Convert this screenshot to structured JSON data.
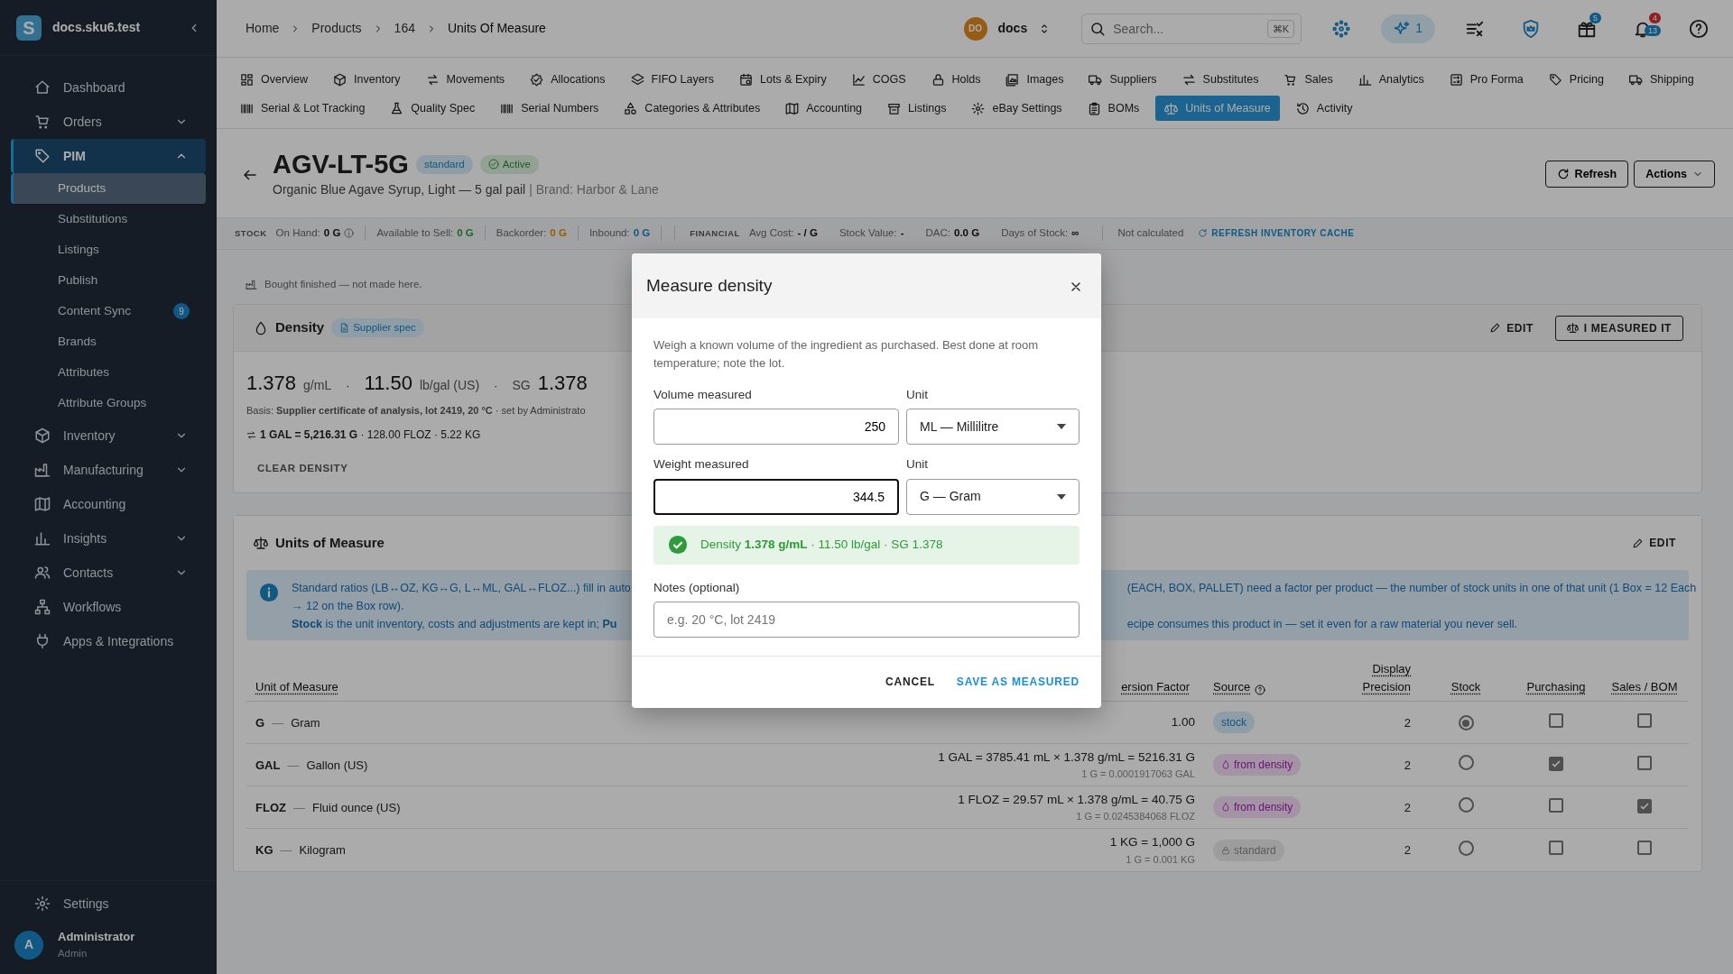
{
  "sidebar": {
    "logo": "S",
    "workspace": "docs.sku6.test",
    "items": [
      {
        "label": "Dashboard",
        "kind": "link",
        "selected": false
      },
      {
        "label": "Orders",
        "kind": "group",
        "expanded": false,
        "selected": false
      },
      {
        "label": "PIM",
        "kind": "group",
        "expanded": true,
        "selected": true,
        "children": [
          {
            "label": "Products",
            "selected": true
          },
          {
            "label": "Substitutions",
            "selected": false
          },
          {
            "label": "Listings",
            "selected": false
          },
          {
            "label": "Publish",
            "selected": false
          },
          {
            "label": "Content Sync",
            "selected": false,
            "badge": "9"
          },
          {
            "label": "Brands",
            "selected": false
          },
          {
            "label": "Attributes",
            "selected": false
          },
          {
            "label": "Attribute Groups",
            "selected": false
          }
        ]
      },
      {
        "label": "Inventory",
        "kind": "group",
        "expanded": false,
        "selected": false
      },
      {
        "label": "Manufacturing",
        "kind": "group",
        "expanded": false,
        "selected": false
      },
      {
        "label": "Accounting",
        "kind": "link",
        "selected": false
      },
      {
        "label": "Insights",
        "kind": "group",
        "expanded": false,
        "selected": false
      },
      {
        "label": "Contacts",
        "kind": "group",
        "expanded": false,
        "selected": false
      },
      {
        "label": "Workflows",
        "kind": "link",
        "selected": false
      },
      {
        "label": "Apps & Integrations",
        "kind": "link",
        "selected": false
      }
    ],
    "settings": "Settings",
    "user": {
      "initial": "A",
      "name": "Administrator",
      "role": "Admin"
    }
  },
  "header": {
    "breadcrumb": [
      "Home",
      "Products",
      "164",
      "Units Of Measure"
    ],
    "account": {
      "initials": "DO",
      "name": "docs"
    },
    "search": {
      "placeholder": "Search...",
      "shortcut": "⌘K"
    },
    "ai_count": "1",
    "gift_badge": "5",
    "notification_badges": [
      "4",
      "13"
    ]
  },
  "tabs": [
    {
      "label": "Overview",
      "selected": false
    },
    {
      "label": "Inventory",
      "selected": false
    },
    {
      "label": "Movements",
      "selected": false
    },
    {
      "label": "Allocations",
      "selected": false
    },
    {
      "label": "FIFO Layers",
      "selected": false
    },
    {
      "label": "Lots & Expiry",
      "selected": false
    },
    {
      "label": "COGS",
      "selected": false
    },
    {
      "label": "Holds",
      "selected": false
    },
    {
      "label": "Images",
      "selected": false
    },
    {
      "label": "Suppliers",
      "selected": false
    },
    {
      "label": "Substitutes",
      "selected": false
    },
    {
      "label": "Sales",
      "selected": false
    },
    {
      "label": "Analytics",
      "selected": false
    },
    {
      "label": "Pro Forma",
      "selected": false
    },
    {
      "label": "Pricing",
      "selected": false
    },
    {
      "label": "Shipping",
      "selected": false
    },
    {
      "label": "Serial & Lot Tracking",
      "selected": false
    },
    {
      "label": "Quality Spec",
      "selected": false
    },
    {
      "label": "Serial Numbers",
      "selected": false
    },
    {
      "label": "Categories & Attributes",
      "selected": false
    },
    {
      "label": "Accounting",
      "selected": false
    },
    {
      "label": "Listings",
      "selected": false
    },
    {
      "label": "eBay Settings",
      "selected": false
    },
    {
      "label": "BOMs",
      "selected": false
    },
    {
      "label": "Units of Measure",
      "selected": true
    },
    {
      "label": "Activity",
      "selected": false
    }
  ],
  "product": {
    "sku": "AGV-LT-5G",
    "badges": [
      {
        "label": "standard",
        "kind": "type"
      },
      {
        "label": "Active",
        "kind": "status"
      }
    ],
    "name": "Organic Blue Agave Syrup, Light — 5 gal pail",
    "brand": "| Brand: Harbor & Lane",
    "refresh": "Refresh",
    "actions": "Actions"
  },
  "stock_bar": {
    "sections": [
      {
        "title": "STOCK",
        "stats": [
          {
            "label": "On Hand:",
            "value": "0 G",
            "kind": "plain",
            "info": true
          },
          {
            "label": "Available to Sell:",
            "value": "0 G",
            "kind": "success"
          },
          {
            "label": "Backorder:",
            "value": "0 G",
            "kind": "warning"
          },
          {
            "label": "Inbound:",
            "value": "0 G",
            "kind": "info"
          }
        ]
      },
      {
        "title": "FINANCIAL",
        "stats": [
          {
            "label": "Avg Cost:",
            "value": "- / G",
            "kind": "plain"
          },
          {
            "label": "Stock Value:",
            "value": "-",
            "kind": "plain"
          },
          {
            "label": "DAC:",
            "value": "0.0 G",
            "kind": "plain"
          },
          {
            "label": "Days of Stock:",
            "value": "∞",
            "kind": "plain"
          }
        ]
      }
    ],
    "note": "Not calculated",
    "action": "REFRESH INVENTORY CACHE"
  },
  "notice": "Bought finished — not made here.",
  "density": {
    "title": "Density",
    "source": "Supplier spec",
    "edit": "EDIT",
    "measure": "I MEASURED IT",
    "separator": "·",
    "readings": [
      {
        "value": "1.378",
        "unit": "g/mL"
      },
      {
        "value": "11.50",
        "unit": "lb/gal (US)"
      },
      {
        "prefix": "SG",
        "value": "1.378"
      }
    ],
    "basis": "Basis: **Supplier certificate of analysis, lot 2419, 20 °C** · set by Administrato",
    "conversions": "**1 GAL = 5,216.31 G** · 128.00 FLOZ · 5.22 KG",
    "clear": "CLEAR DENSITY"
  },
  "uom": {
    "title": "Units of Measure",
    "edit": "EDIT",
    "info": [
      {
        "left": "Standard ratios (LB↔OZ, KG↔G, L↔ML, GAL↔FLOZ...) fill in auto",
        "right": "(EACH, BOX, PALLET) need a factor per product — the number of stock units in one of that unit (1 Box = 12 Each"
      },
      {
        "left": "→ 12 on the Box row)."
      },
      {
        "left": "**Stock** is the unit inventory, costs and adjustments are kept in; **Pu**",
        "right": "ecipe consumes this product in — set it even for a raw material you never sell."
      }
    ],
    "separator": "—",
    "columns": [
      {
        "label": "Unit of Measure"
      },
      {
        "label": "ersion Factor"
      },
      {
        "label": "Source",
        "help": true
      },
      {
        "label": "Display Precision"
      },
      {
        "label": "Stock"
      },
      {
        "label": "Purchasing"
      },
      {
        "label": "Sales / BOM"
      }
    ],
    "rows": [
      {
        "code": "G",
        "name": "Gram",
        "conversion": "1.00",
        "source": {
          "label": "stock",
          "kind": "stock"
        },
        "precision": "2",
        "stock": true,
        "purchasing": false,
        "sales": false
      },
      {
        "code": "GAL",
        "name": "Gallon (US)",
        "conversion": "1 GAL = 3785.41 mL × 1.378 g/mL = 5216.31 G",
        "inverse": "1 G = 0.0001917063 GAL",
        "source": {
          "label": "from density",
          "kind": "density"
        },
        "precision": "2",
        "stock": false,
        "purchasing": true,
        "sales": false
      },
      {
        "code": "FLOZ",
        "name": "Fluid ounce (US)",
        "conversion": "1 FLOZ = 29.57 mL × 1.378 g/mL = 40.75 G",
        "inverse": "1 G = 0.0245384068 FLOZ",
        "source": {
          "label": "from density",
          "kind": "density"
        },
        "precision": "2",
        "stock": false,
        "purchasing": false,
        "sales": true
      },
      {
        "code": "KG",
        "name": "Kilogram",
        "conversion": "1 KG = 1,000 G",
        "inverse": "1 G = 0.001 KG",
        "source": {
          "label": "standard",
          "kind": "standard"
        },
        "precision": "2",
        "stock": false,
        "purchasing": false,
        "sales": false
      }
    ]
  },
  "modal": {
    "title": "Measure density",
    "description": "Weigh a known volume of the ingredient as purchased. Best done at room temperature; note the lot.",
    "fields": [
      {
        "label": "Volume measured",
        "value": "250",
        "focused": false,
        "unit_label": "Unit",
        "unit": "ML — Millilitre"
      },
      {
        "label": "Weight measured",
        "value": "344.5",
        "focused": true,
        "unit_label": "Unit",
        "unit": "G — Gram"
      }
    ],
    "result": {
      "kind": "success",
      "text": "Density **1.378 g/mL** · 11.50 lb/gal · SG 1.378"
    },
    "notes": {
      "label": "Notes (optional)",
      "placeholder": "e.g. 20 °C, lot 2419"
    },
    "buttons": [
      {
        "label": "CANCEL",
        "kind": "text"
      },
      {
        "label": "SAVE AS MEASURED",
        "kind": "primary"
      }
    ]
  }
}
